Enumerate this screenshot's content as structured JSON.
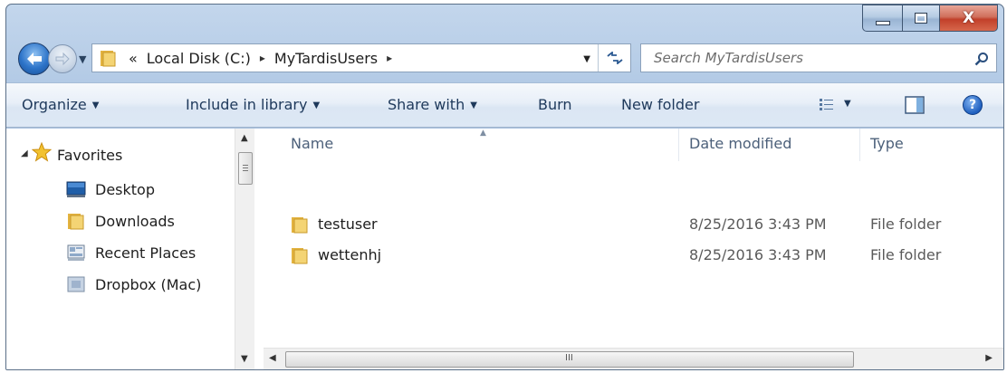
{
  "window": {
    "caption_buttons": {
      "minimize": "minimize-icon",
      "maximize": "maximize-icon",
      "close": "X"
    }
  },
  "address_bar": {
    "overflow": "«",
    "path": [
      "Local Disk (C:)",
      "MyTardisUsers"
    ],
    "separator": "▸"
  },
  "search": {
    "placeholder": "Search MyTardisUsers"
  },
  "command_bar": {
    "organize": "Organize",
    "include_in_library": "Include in library",
    "share_with": "Share with",
    "burn": "Burn",
    "new_folder": "New folder",
    "help": "?"
  },
  "navigation_pane": {
    "favorites": "Favorites",
    "items": [
      {
        "label": "Desktop",
        "icon": "desktop-icon"
      },
      {
        "label": "Downloads",
        "icon": "folder-icon"
      },
      {
        "label": "Recent Places",
        "icon": "recent-places-icon"
      },
      {
        "label": "Dropbox (Mac)",
        "icon": "drive-icon"
      }
    ]
  },
  "file_list": {
    "columns": [
      "Name",
      "Date modified",
      "Type"
    ],
    "rows": [
      {
        "name": "testuser",
        "date_modified": "8/25/2016 3:43 PM",
        "type": "File folder"
      },
      {
        "name": "wettenhj",
        "date_modified": "8/25/2016 3:43 PM",
        "type": "File folder"
      }
    ]
  },
  "scrollbar": {
    "hgrip": "III"
  },
  "colors": {
    "title_bar": "#b4cbe6",
    "close_button": "#c2402a",
    "command_bar": "#e8eff8",
    "text_link": "#1e395b"
  }
}
